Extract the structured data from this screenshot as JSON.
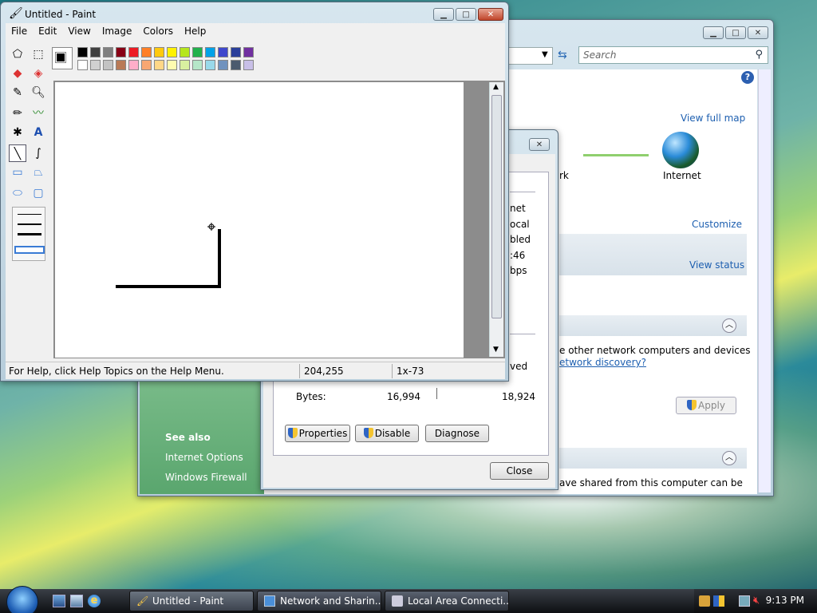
{
  "paint": {
    "title": "Untitled - Paint",
    "menu": [
      "File",
      "Edit",
      "View",
      "Image",
      "Colors",
      "Help"
    ],
    "status_help": "For Help, click Help Topics on the Help Menu.",
    "status_coords": "204,255",
    "status_size": "1x-73",
    "palette_row1": [
      "#000000",
      "#404040",
      "#7f7f7f",
      "#880015",
      "#ed1c24",
      "#ff7f27",
      "#ffc90e",
      "#fff200",
      "#b5e61d",
      "#22b14c",
      "#00a2e8",
      "#3f48cc",
      "#2a3f9a",
      "#7030a0"
    ],
    "palette_row2": [
      "#ffffff",
      "#d0d0d0",
      "#c3c3c3",
      "#b97a57",
      "#ffaec9",
      "#f8a772",
      "#ffd787",
      "#fffbb0",
      "#d9f0a0",
      "#b5e6c8",
      "#99d9ea",
      "#7092be",
      "#4b5a6e",
      "#c8bfe7"
    ]
  },
  "network": {
    "search_placeholder": "Search",
    "view_full_map": "View full map",
    "network_label_partial": "rk",
    "internet_label": "Internet",
    "customize": "Customize",
    "view_status": "View status",
    "discovery_text": "e other network computers and devices",
    "discovery_link": "etwork discovery?",
    "apply": "Apply",
    "shared_text": "ave shared from this computer can be",
    "see_also": "See also",
    "internet_options": "Internet Options",
    "windows_firewall": "Windows Firewall"
  },
  "lac": {
    "rows_partial": [
      "net",
      "ocal",
      "bled",
      ":46",
      "bps"
    ],
    "received_partial": "ved",
    "bytes_label": "Bytes:",
    "bytes_sent": "16,994",
    "bytes_received": "18,924",
    "properties": "Properties",
    "disable": "Disable",
    "diagnose": "Diagnose",
    "close": "Close"
  },
  "taskbar": {
    "tasks": [
      "Untitled - Paint",
      "Network and Sharin...",
      "Local Area Connecti..."
    ],
    "clock": "9:13 PM"
  }
}
